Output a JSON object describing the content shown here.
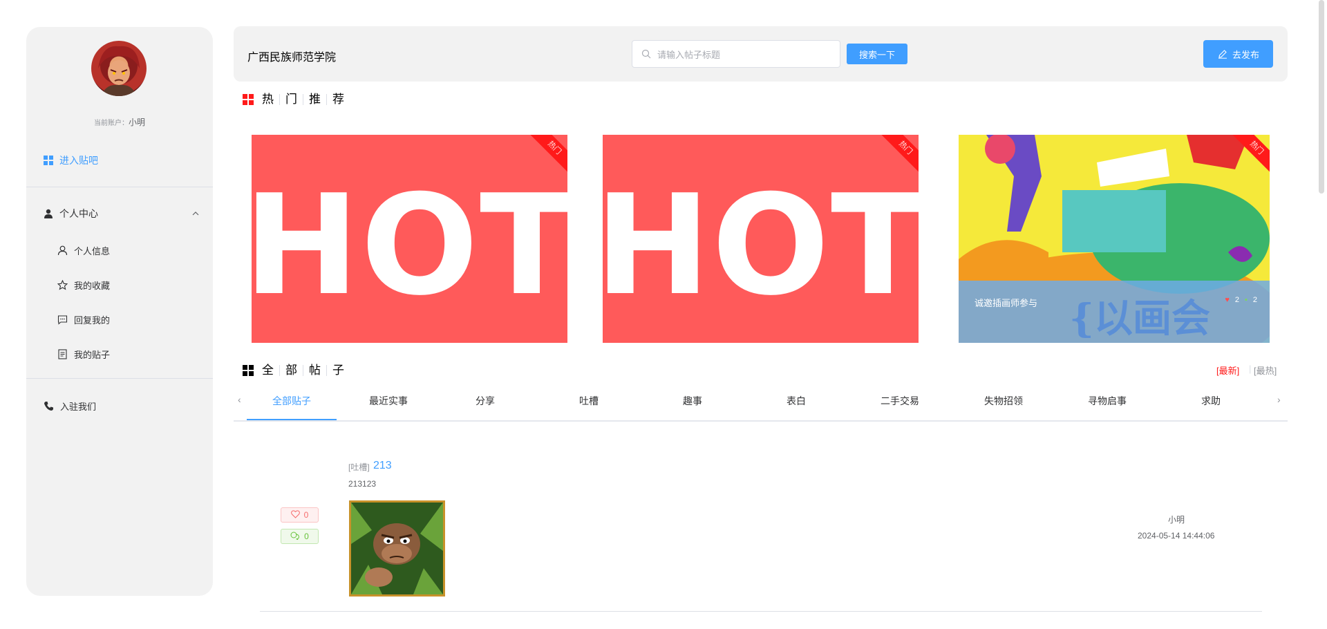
{
  "sidebar": {
    "account_label": "当前账户：",
    "account_name": "小明",
    "enter_label": "进入贴吧",
    "personal_center": "个人中心",
    "sub_items": [
      "个人信息",
      "我的收藏",
      "回复我的",
      "我的贴子"
    ],
    "join_label": "入驻我们"
  },
  "header": {
    "school": "广西民族师范学院",
    "search_placeholder": "请输入帖子标题",
    "search_button": "搜索一下",
    "publish_button": "去发布"
  },
  "hot_section": {
    "title_chars": [
      "热",
      "门",
      "推",
      "荐"
    ],
    "cards": [
      {
        "image_text": "HOT",
        "ribbon": "热门"
      },
      {
        "image_text": "HOT",
        "ribbon": "热门"
      },
      {
        "ribbon": "热门",
        "caption": "诚邀插画师参与",
        "likes": "2",
        "comments": "2",
        "poster_text": "{以画会友}"
      }
    ]
  },
  "all_section": {
    "title_chars": [
      "全",
      "部",
      "帖",
      "子"
    ],
    "sort_latest": "[最新]",
    "sort_hot": "[最热]"
  },
  "tabs": [
    "全部贴子",
    "最近实事",
    "分享",
    "吐槽",
    "趣事",
    "表白",
    "二手交易",
    "失物招领",
    "寻物启事",
    "求助"
  ],
  "post": {
    "category": "[吐槽]",
    "title": "213",
    "content": "213123",
    "likes": "0",
    "replies": "0",
    "author": "小明",
    "time": "2024-05-14 14:44:06"
  },
  "colors": {
    "accent": "#409eff",
    "hot": "#ff5a5a",
    "ribbon": "#ff1a1a",
    "sidebar_bg": "#f2f2f2"
  }
}
